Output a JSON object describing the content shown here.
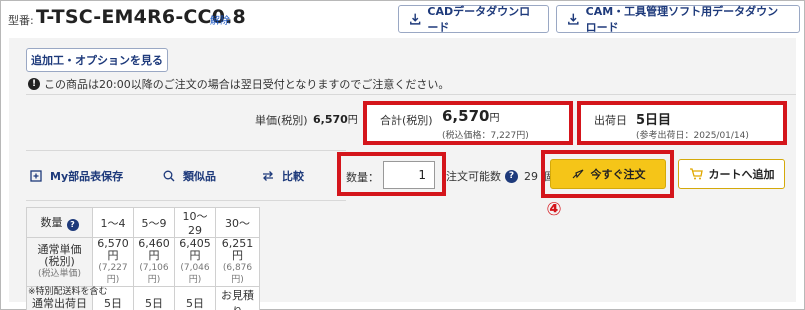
{
  "header": {
    "model_prefix": "型番:",
    "model_number": "T-TSC-EM4R6-CC0.8",
    "clear_label": "解除",
    "cad_download_label": "CADデータダウンロード",
    "cam_download_label": "CAM・工具管理ソフト用データダウンロード"
  },
  "options": {
    "button_label": "追加工・オプションを見る",
    "notice": "この商品は20:00以降のご注文の場合は翌日受付となりますのでご注意ください。"
  },
  "pricing": {
    "unit_price_label": "単価(税別)",
    "unit_price_value": "6,570",
    "yen": "円",
    "total_label": "合計(税別)",
    "total_value": "6,570",
    "total_sub": "(税込価格：7,227円)",
    "ship_label": "出荷日",
    "ship_value": "5日目",
    "ship_sub": "(参考出荷日：2025/01/14)"
  },
  "tools": {
    "save_label": "My部品表保存",
    "similar_label": "類似品",
    "compare_label": "比較"
  },
  "order": {
    "qty_label": "数量：",
    "qty_value": "1",
    "avail_label": "注文可能数",
    "avail_value": "29 個",
    "order_now_label": "今すぐ注文",
    "add_cart_label": "カートへ追加",
    "annotation": "④"
  },
  "volume_table": {
    "qty_header": "数量",
    "ranges": [
      "1〜4",
      "5〜9",
      "10〜29",
      "30〜"
    ],
    "price_label": "通常単価(税別)",
    "price_sublabel": "(税込単価)",
    "prices": [
      "6,570円",
      "6,460円",
      "6,405円",
      "6,251円"
    ],
    "prices_tax": [
      "(7,227円)",
      "(7,106円)",
      "(7,046円)",
      "(6,876円)"
    ],
    "ship_label": "通常出荷日",
    "ship_days": [
      "5日",
      "5日",
      "5日",
      "お見積り"
    ],
    "footnote": "※特別配送料を含む"
  },
  "colors": {
    "accent_navy": "#1e3a7b",
    "highlight_red": "#d4151b",
    "order_yellow": "#f5c518"
  },
  "icons": [
    "download-icon",
    "info-icon",
    "bookmark-add-icon",
    "similar-search-icon",
    "compare-arrows-icon",
    "help-icon",
    "rocket-icon",
    "cart-icon"
  ]
}
